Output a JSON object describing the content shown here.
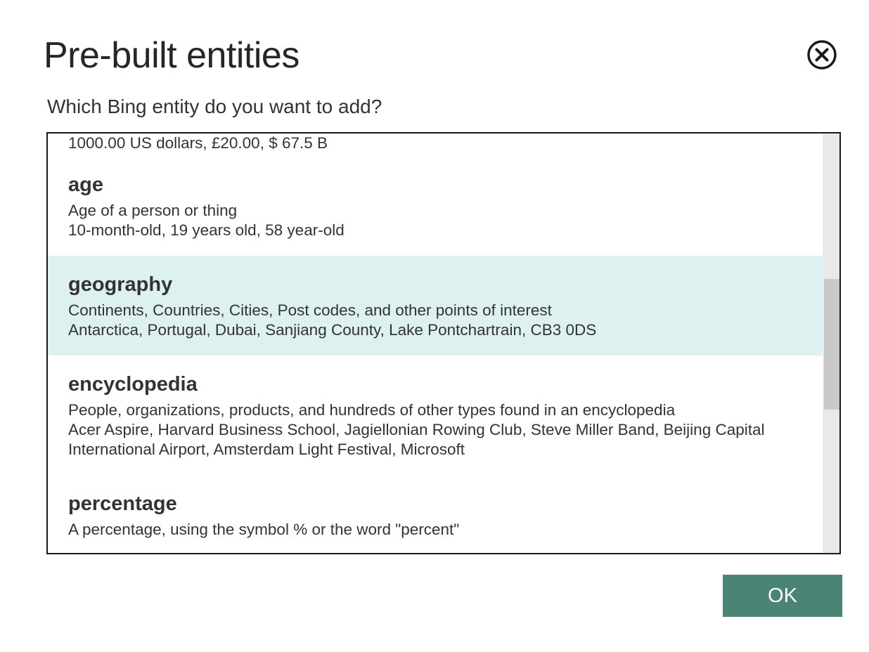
{
  "dialog": {
    "title": "Pre-built entities",
    "question": "Which Bing entity do you want to add?",
    "close_icon": "close-circle-icon",
    "ok_label": "OK"
  },
  "entities": [
    {
      "name": "",
      "description": "",
      "examples": "1000.00 US dollars, £20.00, $ 67.5 B"
    },
    {
      "name": "age",
      "description": "Age of a person or thing",
      "examples": "10-month-old, 19 years old, 58 year-old"
    },
    {
      "name": "geography",
      "description": "Continents, Countries, Cities, Post codes, and other points of interest",
      "examples": "Antarctica, Portugal, Dubai, Sanjiang County, Lake Pontchartrain, CB3 0DS",
      "selected": true
    },
    {
      "name": "encyclopedia",
      "description": "People, organizations, products, and hundreds of other types found in an encyclopedia",
      "examples": "Acer Aspire, Harvard Business School, Jagiellonian Rowing Club, Steve Miller Band, Beijing Capital International Airport, Amsterdam Light Festival, Microsoft"
    },
    {
      "name": "percentage",
      "description": "A percentage, using the symbol % or the word \"percent\"",
      "examples": ""
    }
  ],
  "colors": {
    "selected_row": "#ddf1f1",
    "ok_button": "#4a8474",
    "border": "#1a1a1a"
  }
}
